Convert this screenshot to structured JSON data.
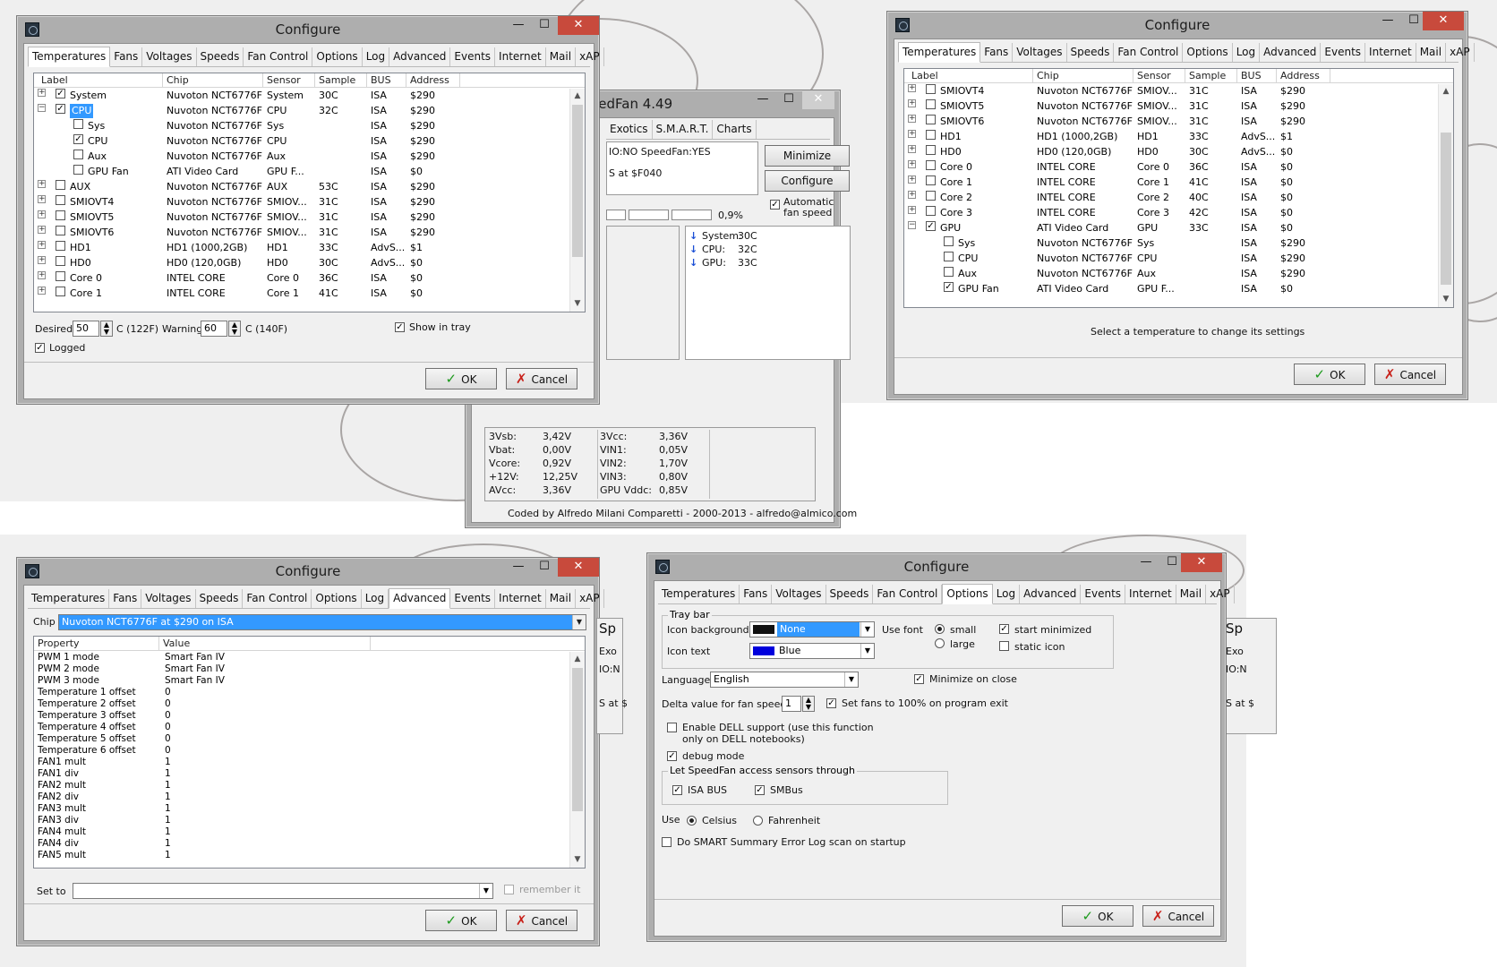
{
  "win1": {
    "title": "Configure",
    "minimize": "—",
    "maximize": "☐",
    "close": "✕",
    "tabs": [
      "Temperatures",
      "Fans",
      "Voltages",
      "Speeds",
      "Fan Control",
      "Options",
      "Log",
      "Advanced",
      "Events",
      "Internet",
      "Mail",
      "xAP"
    ],
    "headers": [
      "Label",
      "Chip",
      "Sensor",
      "Sample",
      "BUS",
      "Address"
    ],
    "rows": [
      {
        "exp": "+",
        "ck": "✓",
        "label": "System",
        "chip": "Nuvoton NCT6776F",
        "sensor": "System",
        "sample": "30C",
        "bus": "ISA",
        "addr": "$290",
        "child": false,
        "sel": false
      },
      {
        "exp": "−",
        "ck": "✓",
        "label": "CPU",
        "chip": "Nuvoton NCT6776F",
        "sensor": "CPU",
        "sample": "32C",
        "bus": "ISA",
        "addr": "$290",
        "child": false,
        "sel": true
      },
      {
        "exp": "",
        "ck": "",
        "label": "Sys",
        "chip": "Nuvoton NCT6776F",
        "sensor": "Sys",
        "sample": "",
        "bus": "ISA",
        "addr": "$290",
        "child": true,
        "sel": false
      },
      {
        "exp": "",
        "ck": "✓",
        "label": "CPU",
        "chip": "Nuvoton NCT6776F",
        "sensor": "CPU",
        "sample": "",
        "bus": "ISA",
        "addr": "$290",
        "child": true,
        "sel": false
      },
      {
        "exp": "",
        "ck": "",
        "label": "Aux",
        "chip": "Nuvoton NCT6776F",
        "sensor": "Aux",
        "sample": "",
        "bus": "ISA",
        "addr": "$290",
        "child": true,
        "sel": false
      },
      {
        "exp": "",
        "ck": "",
        "label": "GPU Fan",
        "chip": "ATI Video Card",
        "sensor": "GPU F...",
        "sample": "",
        "bus": "ISA",
        "addr": "$0",
        "child": true,
        "sel": false
      },
      {
        "exp": "+",
        "ck": "",
        "label": "AUX",
        "chip": "Nuvoton NCT6776F",
        "sensor": "AUX",
        "sample": "53C",
        "bus": "ISA",
        "addr": "$290",
        "child": false,
        "sel": false
      },
      {
        "exp": "+",
        "ck": "",
        "label": "SMIOVT4",
        "chip": "Nuvoton NCT6776F",
        "sensor": "SMIOV...",
        "sample": "31C",
        "bus": "ISA",
        "addr": "$290",
        "child": false,
        "sel": false
      },
      {
        "exp": "+",
        "ck": "",
        "label": "SMIOVT5",
        "chip": "Nuvoton NCT6776F",
        "sensor": "SMIOV...",
        "sample": "31C",
        "bus": "ISA",
        "addr": "$290",
        "child": false,
        "sel": false
      },
      {
        "exp": "+",
        "ck": "",
        "label": "SMIOVT6",
        "chip": "Nuvoton NCT6776F",
        "sensor": "SMIOV...",
        "sample": "31C",
        "bus": "ISA",
        "addr": "$290",
        "child": false,
        "sel": false
      },
      {
        "exp": "+",
        "ck": "",
        "label": "HD1",
        "chip": "HD1 (1000,2GB)",
        "sensor": "HD1",
        "sample": "33C",
        "bus": "AdvS...",
        "addr": "$1",
        "child": false,
        "sel": false
      },
      {
        "exp": "+",
        "ck": "",
        "label": "HD0",
        "chip": "HD0 (120,0GB)",
        "sensor": "HD0",
        "sample": "30C",
        "bus": "AdvS...",
        "addr": "$0",
        "child": false,
        "sel": false
      },
      {
        "exp": "+",
        "ck": "",
        "label": "Core 0",
        "chip": "INTEL CORE",
        "sensor": "Core 0",
        "sample": "36C",
        "bus": "ISA",
        "addr": "$0",
        "child": false,
        "sel": false
      },
      {
        "exp": "+",
        "ck": "",
        "label": "Core 1",
        "chip": "INTEL CORE",
        "sensor": "Core 1",
        "sample": "41C",
        "bus": "ISA",
        "addr": "$0",
        "child": false,
        "sel": false
      }
    ],
    "desired_label": "Desired",
    "desired_value": "50",
    "desired_unit": "C (122F)",
    "warning_label": "Warning",
    "warning_value": "60",
    "warning_unit": "C (140F)",
    "show_tray": "Show in tray",
    "logged": "Logged",
    "ok": "OK",
    "cancel": "Cancel"
  },
  "sf": {
    "title": "SpeedFan 4.49",
    "tabs": [
      "Exotics",
      "S.M.A.R.T.",
      "Charts"
    ],
    "log1": "IO:NO  SpeedFan:YES",
    "log2": "S at $F040",
    "minimize_btn": "Minimize",
    "configure_btn": "Configure",
    "auto_fan": "Automatic fan speed",
    "cpu_usage": "0,9%",
    "temps": [
      {
        "name": "System:",
        "val": "30C"
      },
      {
        "name": "CPU:",
        "val": "32C"
      },
      {
        "name": "GPU:",
        "val": "33C"
      }
    ],
    "volts": [
      {
        "a": "3Vsb:",
        "av": "3,42V",
        "b": "3Vcc:",
        "bv": "3,36V"
      },
      {
        "a": "Vbat:",
        "av": "0,00V",
        "b": "VIN1:",
        "bv": "0,05V"
      },
      {
        "a": "Vcore:",
        "av": "0,92V",
        "b": "VIN2:",
        "bv": "1,70V"
      },
      {
        "a": "+12V:",
        "av": "12,25V",
        "b": "VIN3:",
        "bv": "0,80V"
      },
      {
        "a": "AVcc:",
        "av": "3,36V",
        "b": "GPU Vddc:",
        "bv": "0,85V"
      }
    ],
    "footer": "Coded by Alfredo Milani Comparetti - 2000-2013 - alfredo@almico.com"
  },
  "win2": {
    "title": "Configure",
    "rows": [
      {
        "exp": "+",
        "ck": "",
        "label": "SMIOVT4",
        "chip": "Nuvoton NCT6776F",
        "sensor": "SMIOV...",
        "sample": "31C",
        "bus": "ISA",
        "addr": "$290",
        "child": false
      },
      {
        "exp": "+",
        "ck": "",
        "label": "SMIOVT5",
        "chip": "Nuvoton NCT6776F",
        "sensor": "SMIOV...",
        "sample": "31C",
        "bus": "ISA",
        "addr": "$290",
        "child": false
      },
      {
        "exp": "+",
        "ck": "",
        "label": "SMIOVT6",
        "chip": "Nuvoton NCT6776F",
        "sensor": "SMIOV...",
        "sample": "31C",
        "bus": "ISA",
        "addr": "$290",
        "child": false
      },
      {
        "exp": "+",
        "ck": "",
        "label": "HD1",
        "chip": "HD1 (1000,2GB)",
        "sensor": "HD1",
        "sample": "33C",
        "bus": "AdvS...",
        "addr": "$1",
        "child": false
      },
      {
        "exp": "+",
        "ck": "",
        "label": "HD0",
        "chip": "HD0 (120,0GB)",
        "sensor": "HD0",
        "sample": "30C",
        "bus": "AdvS...",
        "addr": "$0",
        "child": false
      },
      {
        "exp": "+",
        "ck": "",
        "label": "Core 0",
        "chip": "INTEL CORE",
        "sensor": "Core 0",
        "sample": "36C",
        "bus": "ISA",
        "addr": "$0",
        "child": false
      },
      {
        "exp": "+",
        "ck": "",
        "label": "Core 1",
        "chip": "INTEL CORE",
        "sensor": "Core 1",
        "sample": "41C",
        "bus": "ISA",
        "addr": "$0",
        "child": false
      },
      {
        "exp": "+",
        "ck": "",
        "label": "Core 2",
        "chip": "INTEL CORE",
        "sensor": "Core 2",
        "sample": "40C",
        "bus": "ISA",
        "addr": "$0",
        "child": false
      },
      {
        "exp": "+",
        "ck": "",
        "label": "Core 3",
        "chip": "INTEL CORE",
        "sensor": "Core 3",
        "sample": "42C",
        "bus": "ISA",
        "addr": "$0",
        "child": false
      },
      {
        "exp": "−",
        "ck": "✓",
        "label": "GPU",
        "chip": "ATI Video Card",
        "sensor": "GPU",
        "sample": "33C",
        "bus": "ISA",
        "addr": "$0",
        "child": false
      },
      {
        "exp": "",
        "ck": "",
        "label": "Sys",
        "chip": "Nuvoton NCT6776F",
        "sensor": "Sys",
        "sample": "",
        "bus": "ISA",
        "addr": "$290",
        "child": true
      },
      {
        "exp": "",
        "ck": "",
        "label": "CPU",
        "chip": "Nuvoton NCT6776F",
        "sensor": "CPU",
        "sample": "",
        "bus": "ISA",
        "addr": "$290",
        "child": true
      },
      {
        "exp": "",
        "ck": "",
        "label": "Aux",
        "chip": "Nuvoton NCT6776F",
        "sensor": "Aux",
        "sample": "",
        "bus": "ISA",
        "addr": "$290",
        "child": true
      },
      {
        "exp": "",
        "ck": "✓",
        "label": "GPU Fan",
        "chip": "ATI Video Card",
        "sensor": "GPU F...",
        "sample": "",
        "bus": "ISA",
        "addr": "$0",
        "child": true
      }
    ],
    "hint": "Select a temperature to change its settings"
  },
  "win3": {
    "title": "Configure",
    "chip_label": "Chip",
    "chip_value": "Nuvoton NCT6776F at $290 on ISA",
    "headers": [
      "Property",
      "Value"
    ],
    "props": [
      {
        "p": "PWM 1 mode",
        "v": "Smart Fan IV"
      },
      {
        "p": "PWM 2 mode",
        "v": "Smart Fan IV"
      },
      {
        "p": "PWM 3 mode",
        "v": "Smart Fan IV"
      },
      {
        "p": "Temperature 1 offset",
        "v": "0"
      },
      {
        "p": "Temperature 2 offset",
        "v": "0"
      },
      {
        "p": "Temperature 3 offset",
        "v": "0"
      },
      {
        "p": "Temperature 4 offset",
        "v": "0"
      },
      {
        "p": "Temperature 5 offset",
        "v": "0"
      },
      {
        "p": "Temperature 6 offset",
        "v": "0"
      },
      {
        "p": "FAN1 mult",
        "v": "1"
      },
      {
        "p": "FAN1 div",
        "v": "1"
      },
      {
        "p": "FAN2 mult",
        "v": "1"
      },
      {
        "p": "FAN2 div",
        "v": "1"
      },
      {
        "p": "FAN3 mult",
        "v": "1"
      },
      {
        "p": "FAN3 div",
        "v": "1"
      },
      {
        "p": "FAN4 mult",
        "v": "1"
      },
      {
        "p": "FAN4 div",
        "v": "1"
      },
      {
        "p": "FAN5 mult",
        "v": "1"
      }
    ],
    "set_to": "Set to",
    "remember": "remember it"
  },
  "win4": {
    "title": "Configure",
    "tray_bar": "Tray bar",
    "icon_bg": "Icon background",
    "icon_bg_val": "None",
    "use_font": "Use font",
    "small": "small",
    "large": "large",
    "start_min": "start minimized",
    "icon_text": "Icon text",
    "icon_text_val": "Blue",
    "static_icon": "static icon",
    "language": "Language",
    "language_val": "English",
    "min_close": "Minimize on close",
    "delta": "Delta value for fan speeds",
    "delta_val": "1",
    "set_fans": "Set fans to 100% on program exit",
    "dell": "Enable DELL support (use this function only on DELL notebooks)",
    "debug": "debug mode",
    "access": "Let SpeedFan access sensors through",
    "isa": "ISA BUS",
    "smbus": "SMBus",
    "use": "Use",
    "celsius": "Celsius",
    "fahrenheit": "Fahrenheit",
    "smart": "Do SMART Summary Error Log scan on startup"
  },
  "peek": {
    "a": "Sp",
    "b": "Exo",
    "c": "IO:N",
    "d": "S at $"
  },
  "colors": {
    "accent": "#3399ff",
    "close": "#c84a3c",
    "ok_check": "#1c9a1c",
    "cancel_x": "#c8211a",
    "blue_swatch": "#0000dd"
  }
}
